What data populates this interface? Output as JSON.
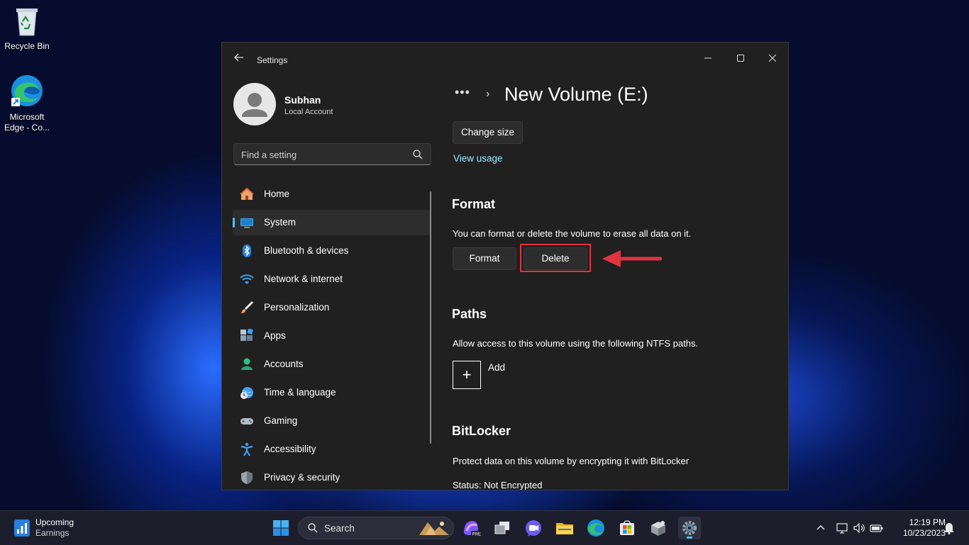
{
  "desktop": {
    "icons": [
      {
        "label": "Recycle Bin"
      },
      {
        "label": "Microsoft Edge - Co..."
      }
    ]
  },
  "window": {
    "title": "Settings",
    "back_icon": "back-arrow-icon",
    "controls": [
      "minimize-icon",
      "maximize-icon",
      "close-icon"
    ]
  },
  "sidebar": {
    "user": {
      "name": "Subhan",
      "account_type": "Local Account"
    },
    "search": {
      "placeholder": "Find a setting",
      "value": ""
    },
    "items": [
      {
        "label": "Home",
        "icon": "home-icon"
      },
      {
        "label": "System",
        "icon": "system-icon",
        "selected": true
      },
      {
        "label": "Bluetooth & devices",
        "icon": "bluetooth-icon"
      },
      {
        "label": "Network & internet",
        "icon": "wifi-icon"
      },
      {
        "label": "Personalization",
        "icon": "brush-icon"
      },
      {
        "label": "Apps",
        "icon": "apps-icon"
      },
      {
        "label": "Accounts",
        "icon": "accounts-icon"
      },
      {
        "label": "Time & language",
        "icon": "clock-globe-icon"
      },
      {
        "label": "Gaming",
        "icon": "gamepad-icon"
      },
      {
        "label": "Accessibility",
        "icon": "accessibility-icon"
      },
      {
        "label": "Privacy & security",
        "icon": "shield-icon"
      }
    ]
  },
  "content": {
    "breadcrumb_more": "•••",
    "breadcrumb_sep": "›",
    "title": "New Volume (E:)",
    "change_size_label": "Change size",
    "view_usage_label": "View usage",
    "format": {
      "title": "Format",
      "description": "You can format or delete the volume to erase all data on it.",
      "format_label": "Format",
      "delete_label": "Delete"
    },
    "paths": {
      "title": "Paths",
      "description": "Allow access to this volume using the following NTFS paths.",
      "add_label": "Add"
    },
    "bitlocker": {
      "title": "BitLocker",
      "description": "Protect data on this volume by encrypting it with BitLocker",
      "status": "Status: Not Encrypted"
    }
  },
  "taskbar": {
    "widget": {
      "line1": "Upcoming",
      "line2": "Earnings"
    },
    "search_label": "Search",
    "clock": {
      "time": "12:19 PM",
      "date": "10/23/2023"
    }
  },
  "colors": {
    "accent": "#4cc2ff",
    "annotation": "#e0343f",
    "link": "#99ebff"
  }
}
